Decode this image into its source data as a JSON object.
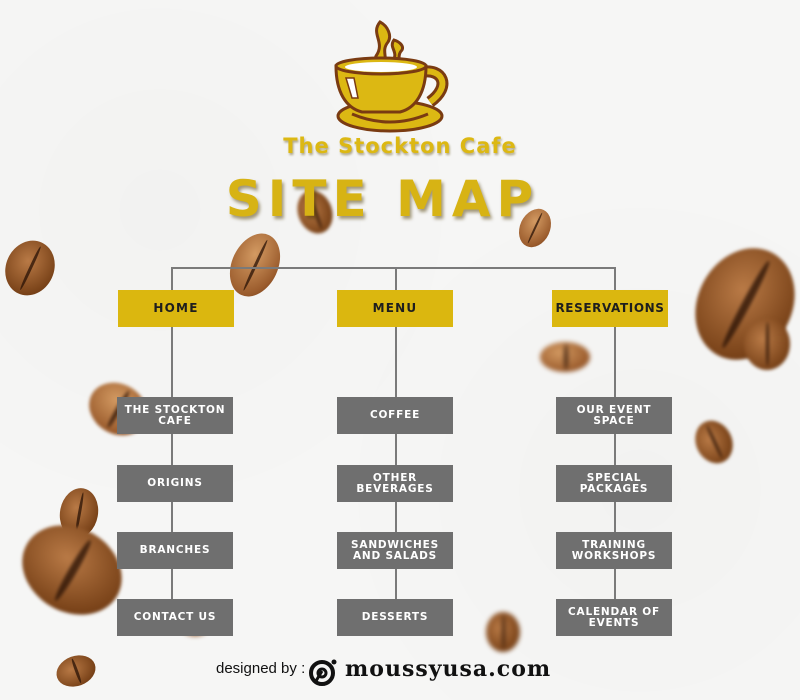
{
  "brand": {
    "name": "The Stockton Cafe",
    "logo_icon": "coffee-cup-icon"
  },
  "title": "SITE MAP",
  "colors": {
    "gold": "#dbb70f",
    "gray_box": "#6f6f6f",
    "connector": "#7a7a7a",
    "logo_outline": "#7a3b12"
  },
  "sitemap": {
    "columns": [
      {
        "label": "HOME",
        "children": [
          {
            "label": "THE STOCKTON CAFE"
          },
          {
            "label": "ORIGINS"
          },
          {
            "label": "BRANCHES"
          },
          {
            "label": "CONTACT US"
          }
        ]
      },
      {
        "label": "MENU",
        "children": [
          {
            "label": "COFFEE"
          },
          {
            "label": "OTHER BEVERAGES"
          },
          {
            "label": "SANDWICHES AND SALADS"
          },
          {
            "label": "DESSERTS"
          }
        ]
      },
      {
        "label": "RESERVATIONS",
        "children": [
          {
            "label": "OUR EVENT SPACE"
          },
          {
            "label": "SPECIAL PACKAGES"
          },
          {
            "label": "TRAINING WORKSHOPS"
          },
          {
            "label": "CALENDAR OF EVENTS"
          }
        ]
      }
    ]
  },
  "footer": {
    "designed_by": "designed by :",
    "site": "moussyusa.com",
    "logo_icon": "moussyusa-logo-icon"
  }
}
